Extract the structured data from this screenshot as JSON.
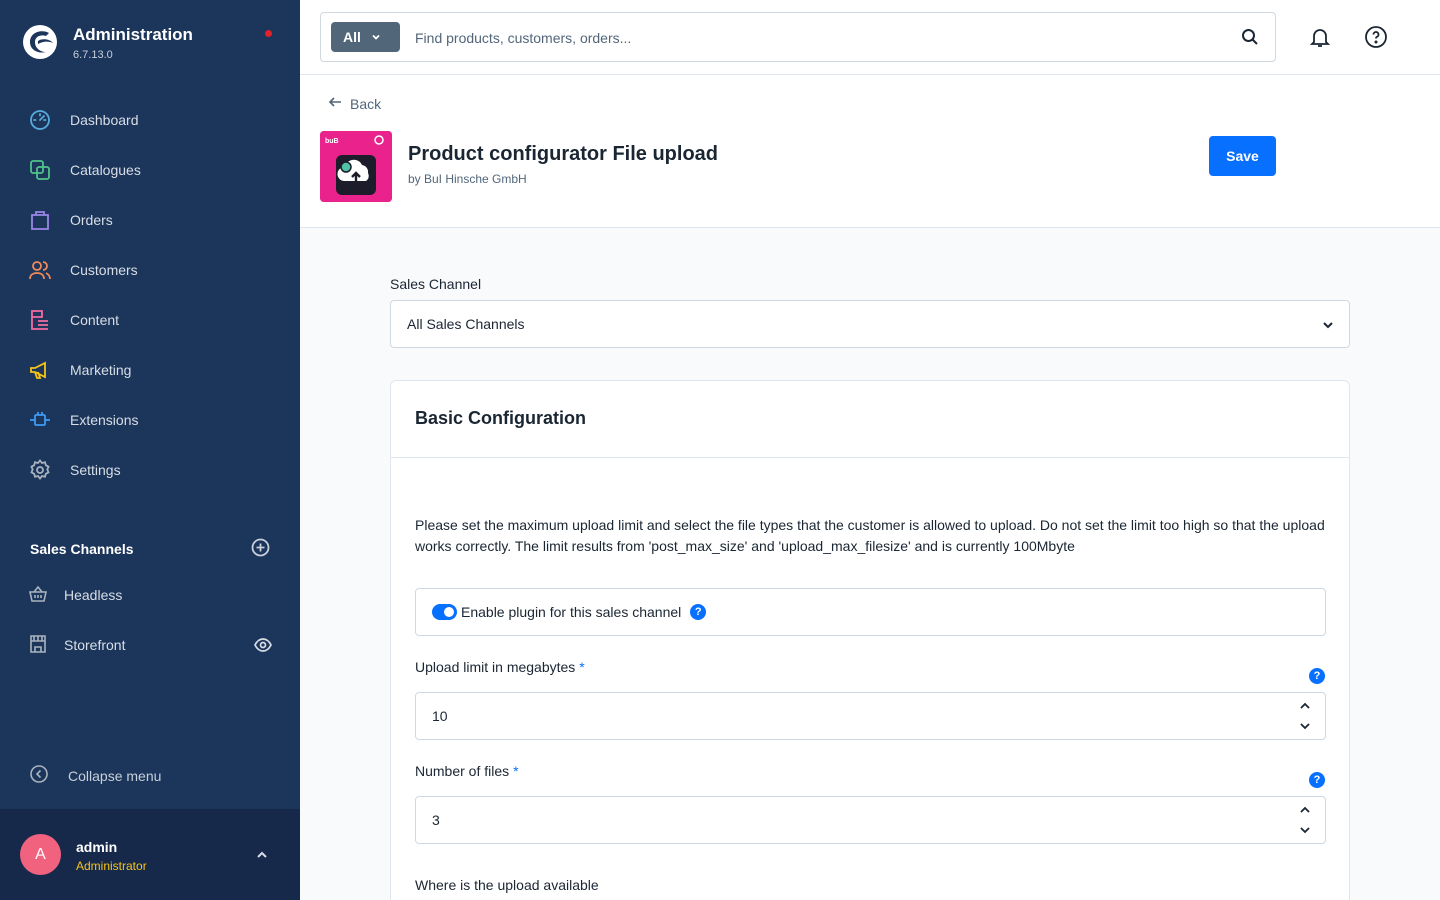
{
  "app": {
    "title": "Administration",
    "version": "6.7.13.0"
  },
  "nav": {
    "items": [
      {
        "label": "Dashboard",
        "icon": "gauge-icon",
        "color": "#57aadc"
      },
      {
        "label": "Catalogues",
        "icon": "catalogue-icon",
        "color": "#50c38c"
      },
      {
        "label": "Orders",
        "icon": "shopping-bag-icon",
        "color": "#9b87e8"
      },
      {
        "label": "Customers",
        "icon": "users-icon",
        "color": "#f08a5b"
      },
      {
        "label": "Content",
        "icon": "content-icon",
        "color": "#f36ba1"
      },
      {
        "label": "Marketing",
        "icon": "megaphone-icon",
        "color": "#f5c518"
      },
      {
        "label": "Extensions",
        "icon": "plug-icon",
        "color": "#3d9bf5"
      },
      {
        "label": "Settings",
        "icon": "gear-icon",
        "color": "#a9b3bf"
      }
    ]
  },
  "sales_channels": {
    "title": "Sales Channels",
    "items": [
      {
        "label": "Headless",
        "icon": "basket-icon"
      },
      {
        "label": "Storefront",
        "icon": "storefront-icon"
      }
    ]
  },
  "collapse_label": "Collapse menu",
  "user": {
    "initial": "A",
    "name": "admin",
    "role": "Administrator"
  },
  "search": {
    "type": "All",
    "placeholder": "Find products, customers, orders..."
  },
  "header": {
    "back_label": "Back",
    "title": "Product configurator File upload",
    "subtitle": "by BuI Hinsche GmbH",
    "save_label": "Save"
  },
  "sales_channel_select": {
    "label": "Sales Channel",
    "value": "All Sales Channels"
  },
  "card": {
    "title": "Basic Configuration",
    "description": "Please set the maximum upload limit and select the file types that the customer is allowed to upload. Do not set the limit too high so that the upload works correctly. The limit results from 'post_max_size' and 'upload_max_filesize' and is currently 100Mbyte",
    "enable_label": "Enable plugin for this sales channel",
    "enabled": true,
    "upload_limit": {
      "label": "Upload limit in megabytes",
      "required": "*",
      "value": "10"
    },
    "num_files": {
      "label": "Number of files",
      "required": "*",
      "value": "3"
    },
    "where_label": "Where is the upload available"
  },
  "help_glyph": "?",
  "colors": {
    "accent": "#0870ff",
    "sidebar": "#1c355a",
    "plugin_icon_bg": "#e9228c"
  }
}
